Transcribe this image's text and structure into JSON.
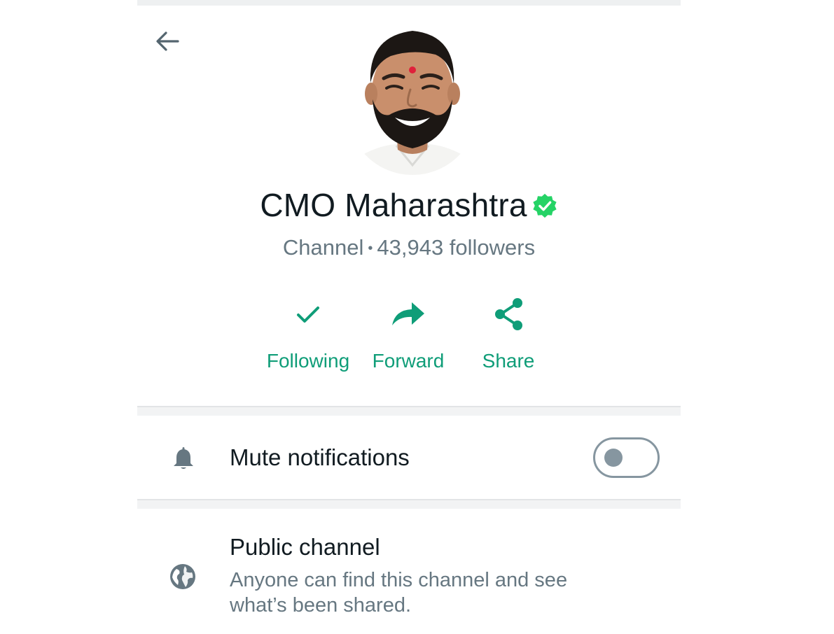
{
  "header": {
    "back_icon": "arrow-left-icon"
  },
  "channel": {
    "name": "CMO Maharashtra",
    "verified_icon": "verified-badge-icon",
    "type_label": "Channel",
    "followers_label": "43,943 followers"
  },
  "actions": [
    {
      "label": "Following",
      "icon": "check-icon"
    },
    {
      "label": "Forward",
      "icon": "forward-arrow-icon"
    },
    {
      "label": "Share",
      "icon": "share-icon"
    }
  ],
  "settings": {
    "mute": {
      "label": "Mute notifications",
      "icon": "bell-icon",
      "enabled": false
    },
    "public": {
      "title": "Public channel",
      "description_line1": "Anyone can find this channel and see",
      "description_line2": "what’s been shared.",
      "icon": "globe-icon"
    }
  },
  "colors": {
    "accent": "#0f9d78",
    "verified": "#25d366",
    "text_primary": "#111b21",
    "text_secondary": "#667781",
    "icon_gray": "#8696a0"
  }
}
